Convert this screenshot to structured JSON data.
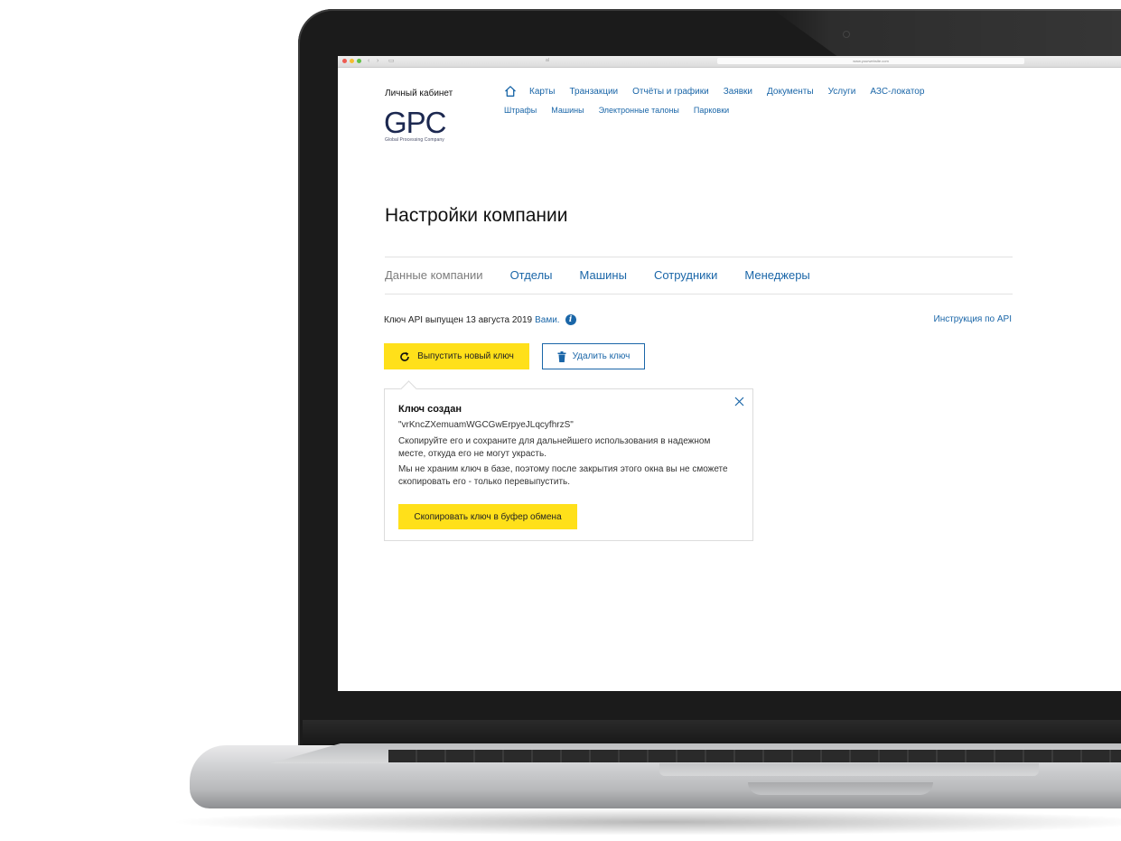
{
  "browser": {
    "url": "www.yourwebsite.com",
    "address_left": "al"
  },
  "header": {
    "cabinet_label": "Личный кабинет",
    "logo_text": "GPC",
    "logo_tagline": "Global Processing Company",
    "nav_primary": [
      "Карты",
      "Транзакции",
      "Отчёты и графики",
      "Заявки",
      "Документы",
      "Услуги",
      "АЗС-локатор"
    ],
    "nav_secondary": [
      "Штрафы",
      "Машины",
      "Электронные талоны",
      "Парковки"
    ]
  },
  "page": {
    "title": "Настройки компании"
  },
  "tabs": [
    {
      "label": "Данные компании",
      "active": true
    },
    {
      "label": "Отделы",
      "active": false
    },
    {
      "label": "Машины",
      "active": false
    },
    {
      "label": "Сотрудники",
      "active": false
    },
    {
      "label": "Менеджеры",
      "active": false
    }
  ],
  "api": {
    "issued_text": "Ключ API выпущен 13 августа 2019",
    "issued_by": "Вами.",
    "instructions_link": "Инструкция по API",
    "issue_button": "Выпустить новый ключ",
    "delete_button": "Удалить ключ"
  },
  "popover": {
    "title": "Ключ создан",
    "key": "\"vrKncZXemuamWGCGwErpyeJLqcyfhrzS\"",
    "text1": "Скопируйте его и сохраните для дальнейшего использования в надежном месте, откуда его не могут украсть.",
    "text2": "Мы не храним ключ в базе, поэтому после закрытия этого окна вы не сможете скопировать его - только перевыпустить.",
    "copy_button": "Скопировать ключ в буфер обмена"
  },
  "colors": {
    "accent_yellow": "#ffe01a",
    "link_blue": "#1a66a8",
    "logo_navy": "#1c2850"
  }
}
